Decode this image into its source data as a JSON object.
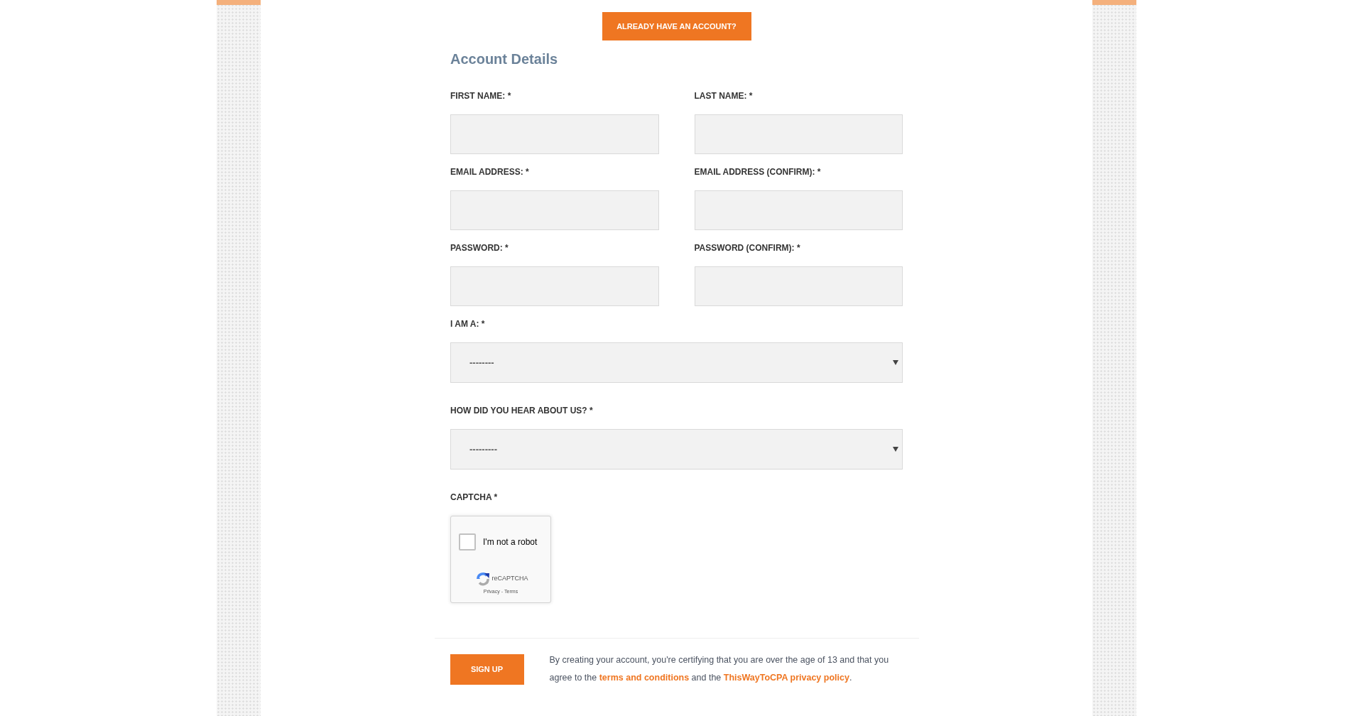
{
  "top_button": {
    "label": "ALREADY HAVE AN ACCOUNT?"
  },
  "section_title": "Account Details",
  "fields": [
    {
      "label": "FIRST NAME: *"
    },
    {
      "label": "LAST NAME: *"
    },
    {
      "label": "EMAIL ADDRESS: *"
    },
    {
      "label": "EMAIL ADDRESS (CONFIRM): *"
    },
    {
      "label": "PASSWORD: *"
    },
    {
      "label": "PASSWORD (CONFIRM): *"
    }
  ],
  "selects": [
    {
      "label": "I AM A: *",
      "value": "--------"
    },
    {
      "label": "HOW DID YOU HEAR ABOUT US? *",
      "value": "---------"
    }
  ],
  "captcha": {
    "label": "CAPTCHA *",
    "checkbox_text": "I'm not a robot",
    "checked": false,
    "brand": "reCAPTCHA",
    "privacy_link": "Privacy",
    "separator": "-",
    "terms_link": "Terms"
  },
  "footer": {
    "button": "SIGN UP",
    "consent": [
      {
        "kind": "text",
        "text": "By creating your account, you're certifying that you are over the age of 13 and that you agree to the "
      },
      {
        "kind": "link",
        "text": "terms and conditions"
      },
      {
        "kind": "text",
        "text": " and the "
      },
      {
        "kind": "link",
        "text": "ThisWayToCPA privacy policy"
      },
      {
        "kind": "text",
        "text": "."
      }
    ]
  }
}
